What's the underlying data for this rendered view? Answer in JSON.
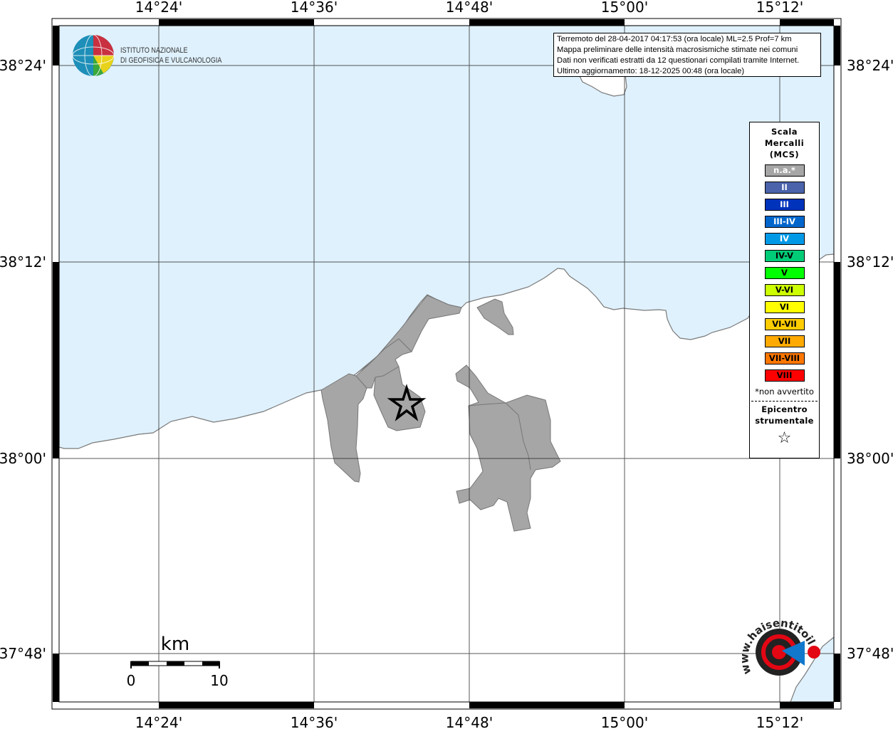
{
  "map": {
    "top_axis_labels": [
      "14°24'",
      "14°36'",
      "14°48'",
      "15°00'",
      "15°12'"
    ],
    "bottom_axis_labels": [
      "14°24'",
      "14°36'",
      "14°48'",
      "15°00'",
      "15°12'"
    ],
    "left_axis_labels": [
      "38°24'",
      "38°12'",
      "38°00'",
      "37°48'"
    ],
    "right_axis_labels": [
      "38°24'",
      "38°12'",
      "38°00'",
      "37°48'"
    ],
    "colors": {
      "sea": "#dff1fd",
      "land": "#ffffff",
      "affected_na": "#a6a6a6",
      "coastline": "#7a7a7a"
    },
    "epicenter_symbol": "star-icon"
  },
  "info_box": {
    "lines": [
      "Terremoto del 28-04-2017 04:17:53 (ora locale) ML=2.5 Prof=7 km",
      "Mappa preliminare delle intensità macrosismiche stimate nei comuni",
      "Dati non verificati estratti da 12 questionari compilati tramite Internet.",
      "Ultimo aggiornamento: 18-12-2025 00:48 (ora locale)"
    ]
  },
  "legend": {
    "title_lines": [
      "Scala",
      "Mercalli",
      "(MCS)"
    ],
    "items": [
      {
        "label": "n.a.*",
        "color": "#a6a6a6",
        "text_color": "#ffffff"
      },
      {
        "label": "II",
        "color": "#4a63ab",
        "text_color": "#ffffff"
      },
      {
        "label": "III",
        "color": "#0033bb",
        "text_color": "#ffffff"
      },
      {
        "label": "III-IV",
        "color": "#0066cc",
        "text_color": "#ffffff"
      },
      {
        "label": "IV",
        "color": "#0099e6",
        "text_color": "#ffffff"
      },
      {
        "label": "IV-V",
        "color": "#00cc77",
        "text_color": "#000000"
      },
      {
        "label": "V",
        "color": "#00ff00",
        "text_color": "#000000"
      },
      {
        "label": "V-VI",
        "color": "#ccff00",
        "text_color": "#000000"
      },
      {
        "label": "VI",
        "color": "#ffff00",
        "text_color": "#000000"
      },
      {
        "label": "VI-VII",
        "color": "#ffcc00",
        "text_color": "#000000"
      },
      {
        "label": "VII",
        "color": "#ffaa00",
        "text_color": "#000000"
      },
      {
        "label": "VII-VIII",
        "color": "#ff7700",
        "text_color": "#000000"
      },
      {
        "label": "VIII",
        "color": "#ff0000",
        "text_color": "#000000"
      }
    ],
    "note": "*non avvertito",
    "epicenter_lines": [
      "Epicentro",
      "strumentale"
    ],
    "epicenter_symbol": "☆"
  },
  "logos": {
    "ingv_lines": [
      "ISTITUTO NAZIONALE",
      "DI GEOFISICA E VULCANOLOGIA"
    ],
    "hst_text": "www.haisentitoilterremoto.it"
  },
  "scale_bar": {
    "unit": "km",
    "labels": [
      "0",
      "10"
    ]
  }
}
